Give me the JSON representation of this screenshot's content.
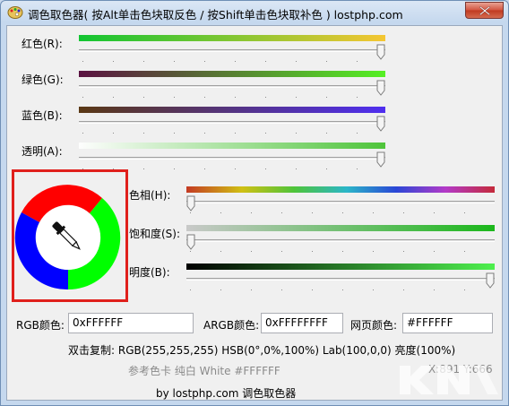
{
  "window": {
    "title": "调色取色器( 按Alt单击色块取反色 / 按Shift单击色块取补色 ) lostphp.com"
  },
  "sliders": [
    {
      "label": "红色(R):",
      "value": 1.0
    },
    {
      "label": "绿色(G):",
      "value": 1.0
    },
    {
      "label": "蓝色(B):",
      "value": 1.0
    },
    {
      "label": "透明(A):",
      "value": 1.0
    }
  ],
  "hsb_sliders": [
    {
      "label": "色相(H):",
      "value": 0.0
    },
    {
      "label": "饱和度(S):",
      "value": 0.0
    },
    {
      "label": "明度(B):",
      "value": 1.0
    }
  ],
  "fields": {
    "rgb_label": "RGB颜色:",
    "rgb_value": "0xFFFFFF",
    "argb_label": "ARGB颜色:",
    "argb_value": "0xFFFFFFFF",
    "web_label": "网页颜色:",
    "web_value": "#FFFFFF"
  },
  "copy_line": "双击复制: RGB(255,255,255) HSB(0°,0%,100%) Lab(100,0,0) 亮度(100%)",
  "reference_line": "参考色卡 纯白 White #FFFFFF",
  "coords": "X:891 Y:666",
  "footer": "by lostphp.com 调色取色器",
  "icons": {
    "title": "palette-icon",
    "picker": "eyedropper-icon",
    "close": "close-icon"
  },
  "colors": {
    "wheel_red": "#ff0000",
    "wheel_green": "#00ff00",
    "wheel_blue": "#0000ff",
    "highlight_border": "#e0201c"
  }
}
